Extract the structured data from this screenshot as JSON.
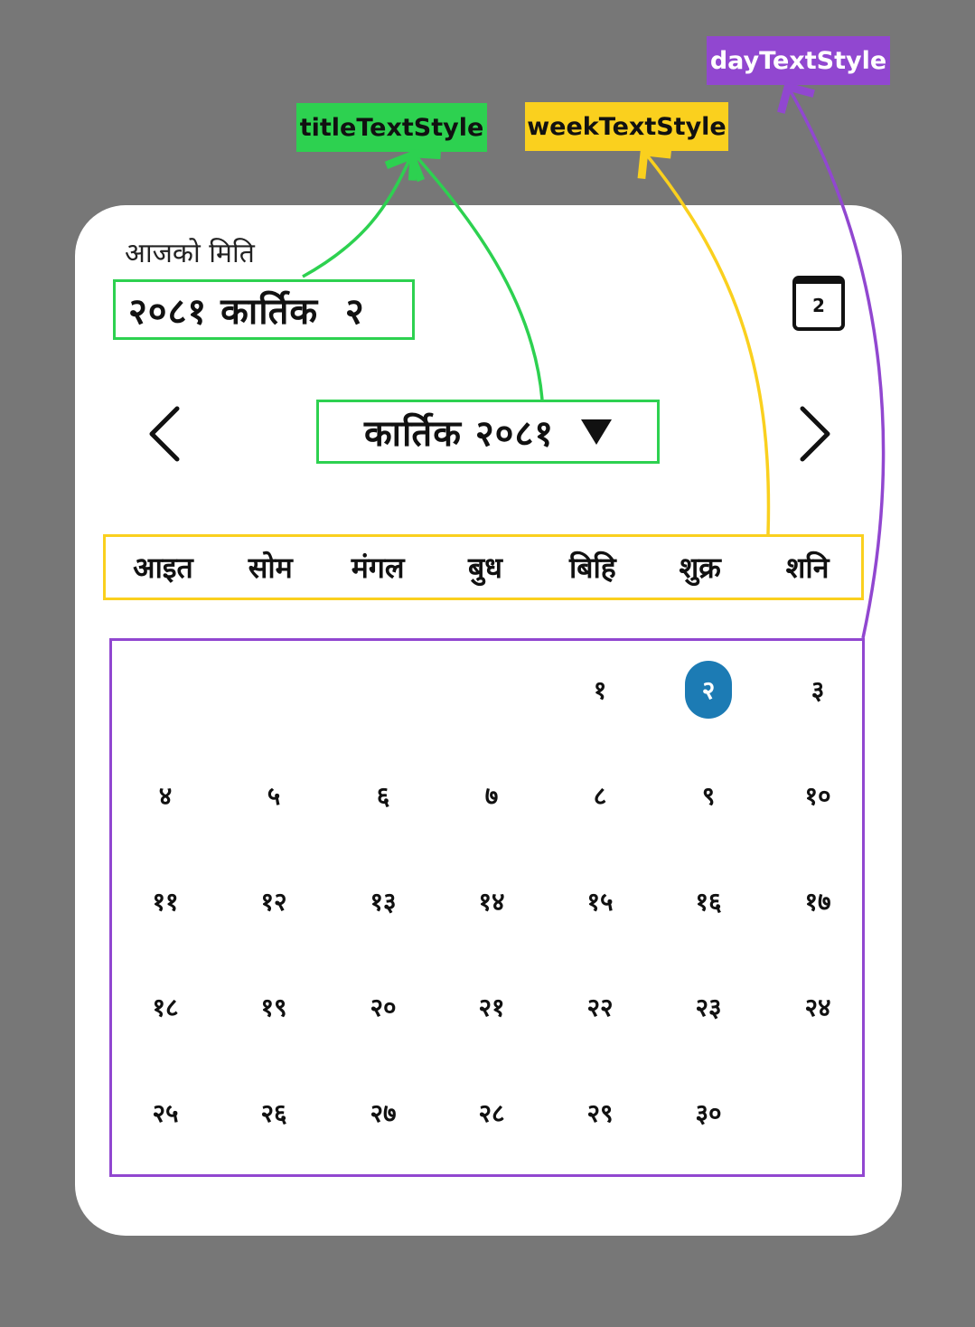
{
  "annotations": {
    "title_style": "titleTextStyle",
    "week_style": "weekTextStyle",
    "day_style": "dayTextStyle"
  },
  "colors": {
    "background": "#777777",
    "title_annotation": "#2dd150",
    "week_annotation": "#fad01e",
    "day_annotation": "#9147d0",
    "selected_day": "#1c7bb4"
  },
  "header": {
    "today_label": "आजको मिति",
    "today_date": "२०८१ कार्तिक  २",
    "calendar_button_text": "2",
    "calendar_button_icon": "calendar-icon"
  },
  "navigation": {
    "prev_icon": "chevron-left-icon",
    "next_icon": "chevron-right-icon",
    "month_year": "कार्तिक २०८१",
    "dropdown_icon": "caret-down-icon"
  },
  "weekdays": [
    "आइत",
    "सोम",
    "मंगल",
    "बुध",
    "बिहि",
    "शुक्र",
    "शनि"
  ],
  "days": [
    [
      "",
      "",
      "",
      "",
      "१",
      "२",
      "३"
    ],
    [
      "४",
      "५",
      "६",
      "७",
      "८",
      "९",
      "१०"
    ],
    [
      "११",
      "१२",
      "१३",
      "१४",
      "१५",
      "१६",
      "१७"
    ],
    [
      "१८",
      "१९",
      "२०",
      "२१",
      "२२",
      "२३",
      "२४"
    ],
    [
      "२५",
      "२६",
      "२७",
      "२८",
      "२९",
      "३०",
      ""
    ]
  ],
  "selected_day": "२"
}
